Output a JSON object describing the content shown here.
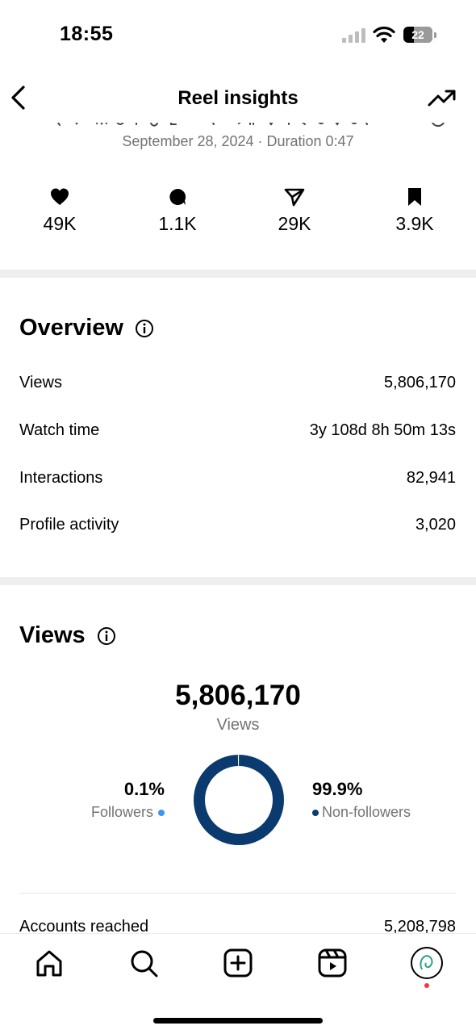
{
  "status_bar": {
    "time": "18:55",
    "battery": "22"
  },
  "header": {
    "title": "Reel insights",
    "back_icon": "chevron-left-icon",
    "trend_icon": "trending-up-icon"
  },
  "reel": {
    "meta": "September 28, 2024 · Duration 0:47"
  },
  "stats": [
    {
      "icon": "heart-icon",
      "value": "49K"
    },
    {
      "icon": "comment-icon",
      "value": "1.1K"
    },
    {
      "icon": "send-icon",
      "value": "29K"
    },
    {
      "icon": "bookmark-icon",
      "value": "3.9K"
    }
  ],
  "overview": {
    "title": "Overview",
    "rows": [
      {
        "label": "Views",
        "value": "5,806,170"
      },
      {
        "label": "Watch time",
        "value": "3y 108d 8h 50m 13s"
      },
      {
        "label": "Interactions",
        "value": "82,941"
      },
      {
        "label": "Profile activity",
        "value": "3,020"
      }
    ]
  },
  "views": {
    "title": "Views",
    "total": "5,806,170",
    "caption": "Views",
    "followers": {
      "pct": "0.1%",
      "label": "Followers",
      "color": "#3897f0",
      "share": 0.001
    },
    "non_followers": {
      "pct": "99.9%",
      "label": "Non-followers",
      "color": "#0b3a6e",
      "share": 0.999
    },
    "accounts_reached": {
      "label": "Accounts reached",
      "value": "5,208,798"
    }
  },
  "tab_bar": {
    "items": [
      "home-icon",
      "search-icon",
      "create-icon",
      "reels-icon",
      "profile-avatar"
    ],
    "accent": "#ff3040"
  }
}
